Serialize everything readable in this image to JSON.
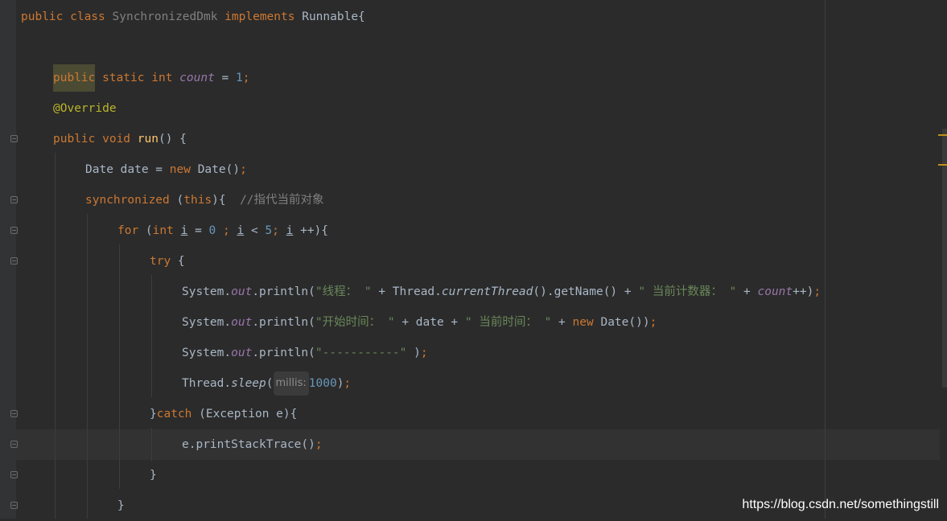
{
  "editor": {
    "colors": {
      "background": "#2b2b2b",
      "keyword": "#cc7832",
      "string": "#6a8759",
      "number": "#6897bb",
      "field": "#9876aa",
      "annotation": "#bbb529",
      "comment": "#808080",
      "text": "#a9b7c6"
    },
    "icons": [
      "fold-icon"
    ],
    "lines": {
      "l1": {
        "kw1": "public class ",
        "name": "SynchronizedDmk",
        "kw2": " implements ",
        "iface": "Runnable{"
      },
      "l3": {
        "kw1": "public",
        "kw2": " static int ",
        "field": "count",
        "eq": " = ",
        "num": "1",
        "semi": ";"
      },
      "l4": {
        "ann": "@Override"
      },
      "l5": {
        "kw": "public void ",
        "fn": "run",
        "rest": "() {"
      },
      "l6": {
        "p1": "Date date = ",
        "kw": "new",
        "p2": " Date()",
        "semi": ";"
      },
      "l7": {
        "kw": "synchronized",
        "p1": " (",
        "this": "this",
        "p2": "){  ",
        "comment": "//指代当前对象"
      },
      "l8": {
        "kw": "for",
        "p1": " (",
        "kw2": "int",
        "sp1": " ",
        "i1": "i",
        "p2": " = ",
        "n0": "0",
        "semi1": " ;",
        "sp2": " ",
        "i2": "i",
        "p3": " < ",
        "n5": "5",
        "semi2": ";",
        "sp3": " ",
        "i3": "i",
        "p4": " ++){"
      },
      "l9": {
        "kw": "try",
        "rest": " {"
      },
      "l10": {
        "p1": "System.",
        "out": "out",
        "p2": ".println(",
        "s1": "\"线程： \"",
        "p3": " + Thread.",
        "m": "currentThread",
        "p4": "().getName() + ",
        "s2": "\" 当前计数器： \"",
        "p5": " + ",
        "cnt": "count",
        "p6": "++)",
        "semi": ";"
      },
      "l11": {
        "p1": "System.",
        "out": "out",
        "p2": ".println(",
        "s1": "\"开始时间： \"",
        "p3": " + date + ",
        "s2": "\" 当前时间： \"",
        "p4": " + ",
        "kw": "new",
        "p5": " Date())",
        "semi": ";"
      },
      "l12": {
        "p1": "System.",
        "out": "out",
        "p2": ".println(",
        "s1": "\"-----------\"",
        "p3": " )",
        "semi": ";"
      },
      "l13": {
        "p1": "Thread.",
        "m": "sleep",
        "p2": "(",
        "hint": "millis:",
        "num": "1000",
        "p3": ")",
        "semi": ";"
      },
      "l14": {
        "p1": "}",
        "kw": "catch",
        "p2": " (Exception e){"
      },
      "l15": {
        "p1": "e.printStackTrace()",
        "semi": ";"
      },
      "l16": {
        "p1": "}"
      },
      "l17": {
        "p1": "}"
      }
    }
  },
  "watermark": "https://blog.csdn.net/somethingstill"
}
